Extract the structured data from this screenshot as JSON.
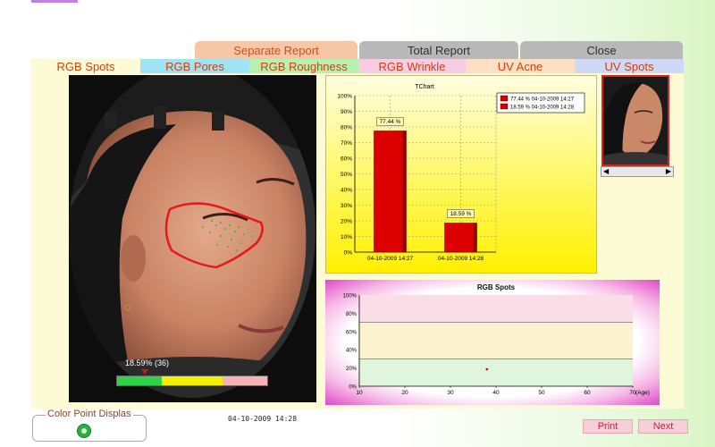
{
  "main_tabs": [
    {
      "label": "Separate Report",
      "bg": "#f7c6a6",
      "color": "#c8501e"
    },
    {
      "label": "Total Report",
      "bg": "#b8b8b8",
      "color": "#303030"
    },
    {
      "label": "Close",
      "bg": "#b8b8b8",
      "color": "#303030"
    }
  ],
  "sub_tabs": [
    {
      "label": "RGB Spots",
      "bg": "#fdfbd6"
    },
    {
      "label": "RGB Pores",
      "bg": "#9ee4f4"
    },
    {
      "label": "RGB Roughness",
      "bg": "#b8f0b0"
    },
    {
      "label": "RGB Wrinkle",
      "bg": "#f8cce2"
    },
    {
      "label": "UV Acne",
      "bg": "#fde0c4"
    },
    {
      "label": "UV Spots",
      "bg": "#cfd8f4"
    }
  ],
  "photo": {
    "readout": "18.59% (36)"
  },
  "chart_data": [
    {
      "type": "bar",
      "title": "TChart",
      "categories": [
        "04-10-2009 14:27",
        "04-10-2009 14:28"
      ],
      "values": [
        77.44,
        18.59
      ],
      "value_labels": [
        "77.44 %",
        "18.59 %"
      ],
      "legend": [
        "77.44 % 04-10-2009 14:27",
        "18.59 % 04-10-2009 14:28"
      ],
      "legend_position": "top-right",
      "bar_color": "#dd0000",
      "ylim": [
        0,
        100
      ],
      "yticks": [
        "0%",
        "10%",
        "20%",
        "30%",
        "40%",
        "50%",
        "60%",
        "70%",
        "80%",
        "90%",
        "100%"
      ],
      "grid": true
    },
    {
      "type": "scatter",
      "title": "RGB Spots",
      "xlabel": "(Age)",
      "xlim": [
        10,
        70
      ],
      "ylim": [
        0,
        100
      ],
      "xticks": [
        "10",
        "20",
        "30",
        "40",
        "50",
        "60",
        "70"
      ],
      "yticks": [
        "0%",
        "20%",
        "40%",
        "60%",
        "80%",
        "100%"
      ],
      "bands": [
        {
          "from": 0,
          "to": 30,
          "color": "#dff6dc"
        },
        {
          "from": 30,
          "to": 70,
          "color": "#fbf2cf"
        },
        {
          "from": 70,
          "to": 100,
          "color": "#fbdde8"
        }
      ],
      "points": [
        {
          "x": 38,
          "y": 18.59
        }
      ],
      "point_color": "#e00000"
    }
  ],
  "color_point": {
    "title": "Color Point Displas"
  },
  "timestamp": "04-10-2009 14:28",
  "buttons": {
    "print": "Print",
    "next": "Next"
  }
}
